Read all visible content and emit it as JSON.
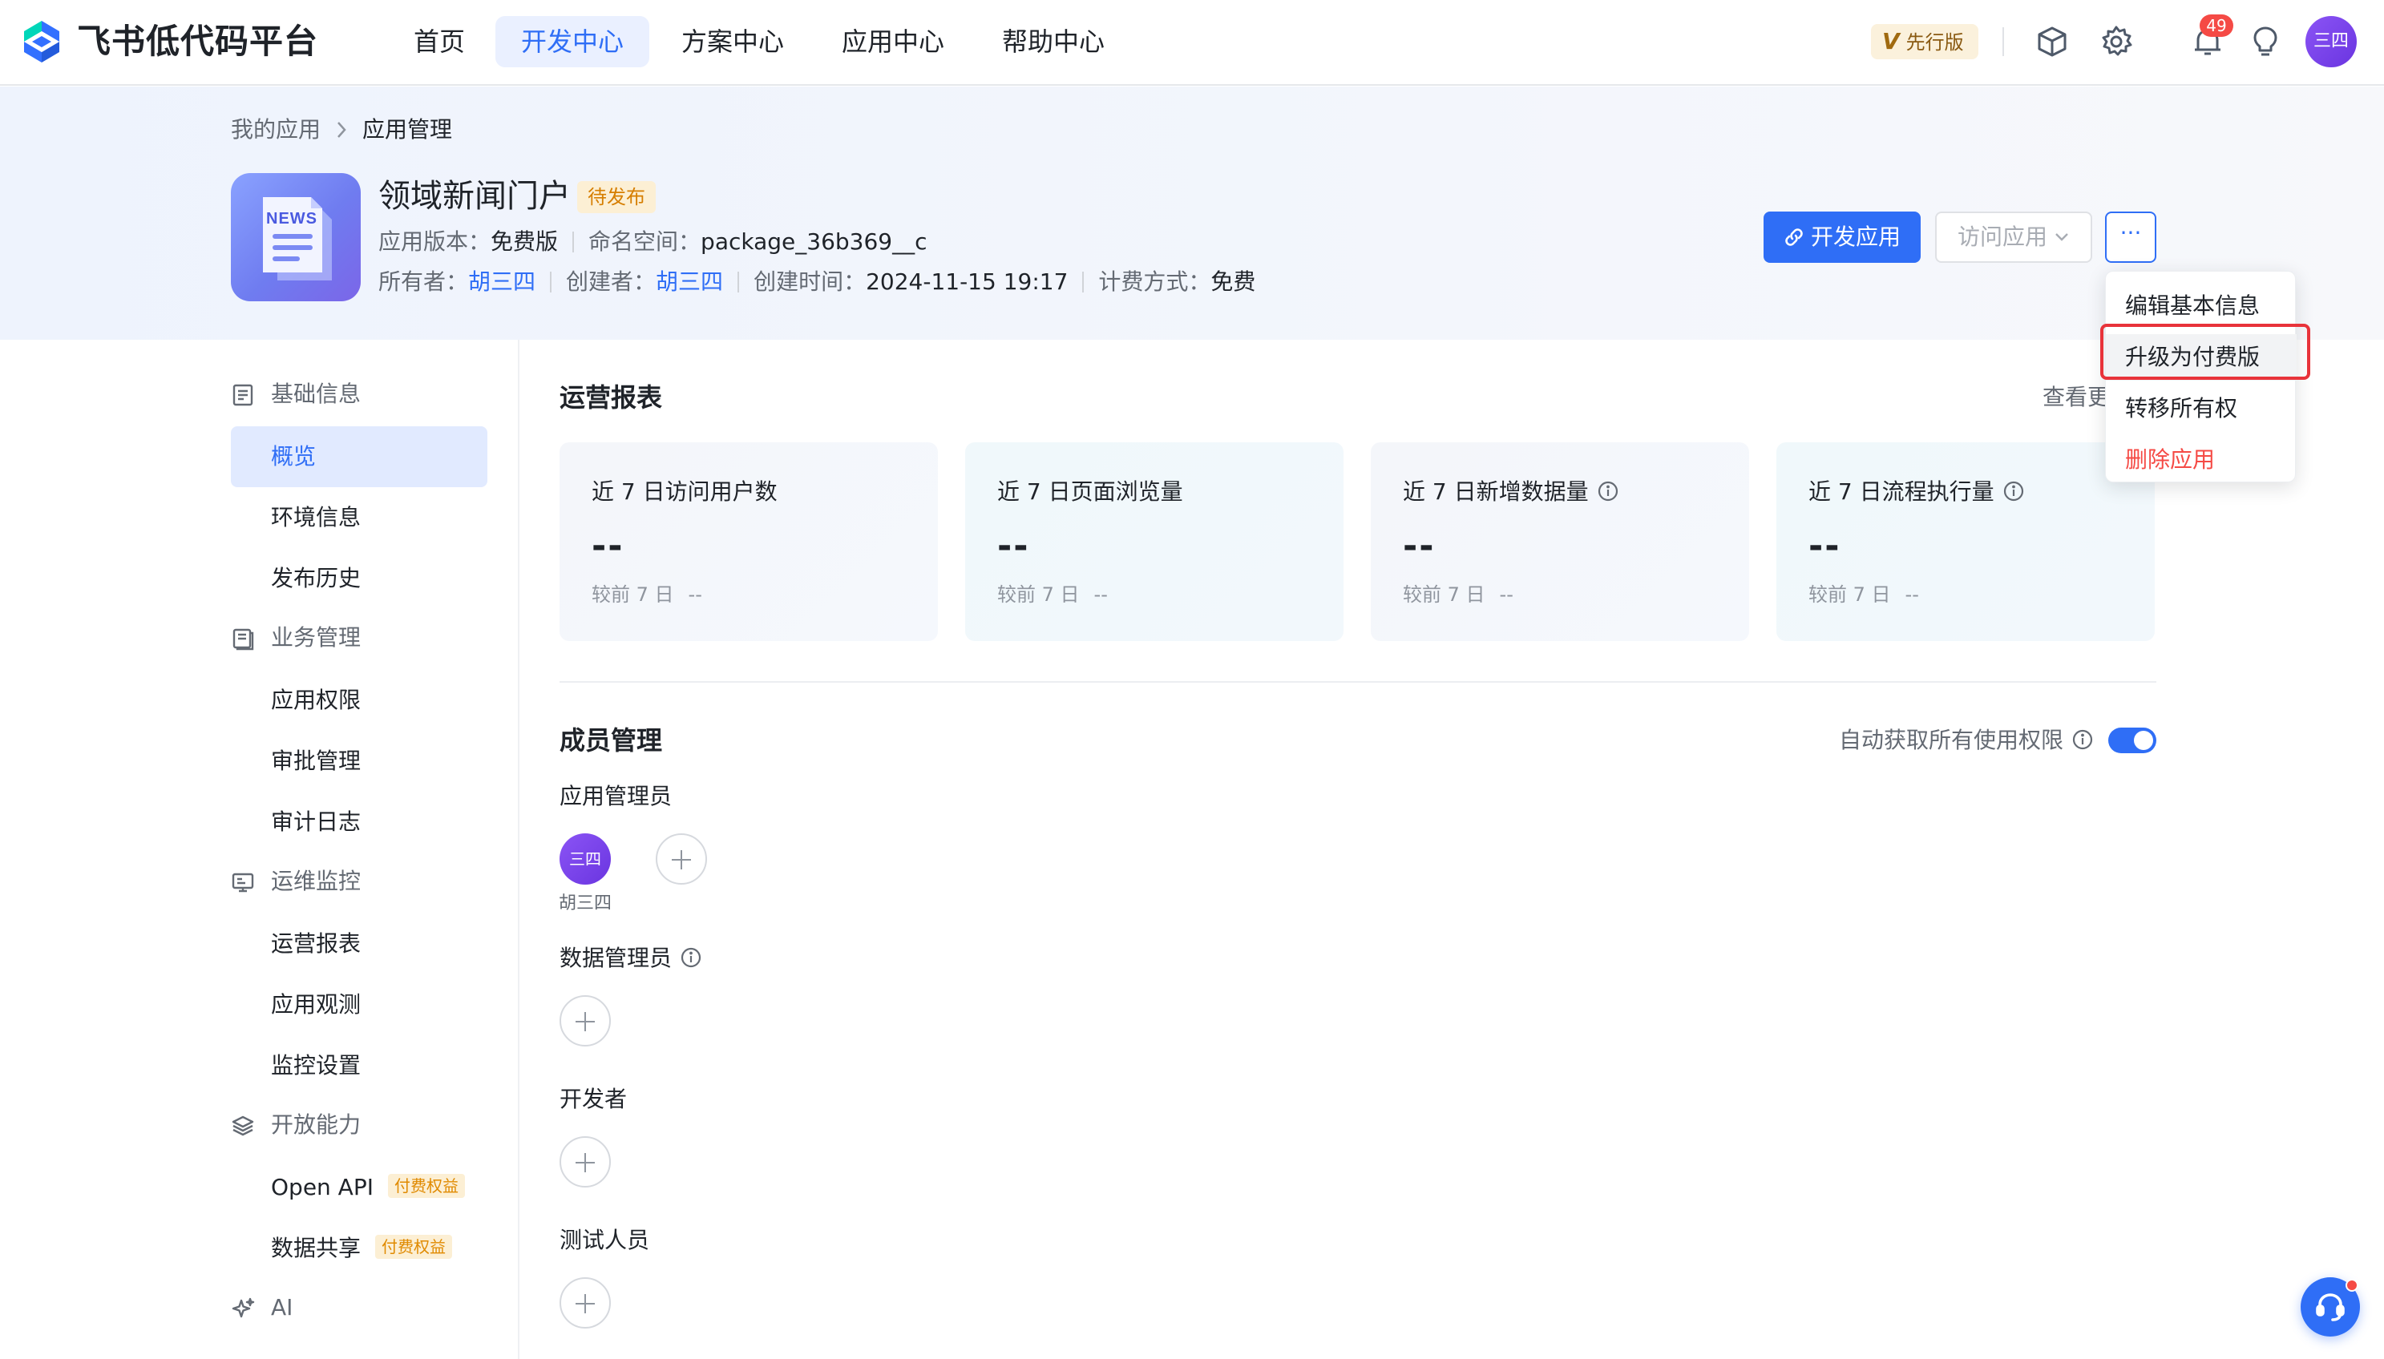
{
  "brand": {
    "name": "飞书低代码平台"
  },
  "nav": {
    "tabs": [
      {
        "label": "首页"
      },
      {
        "label": "开发中心"
      },
      {
        "label": "方案中心"
      },
      {
        "label": "应用中心"
      },
      {
        "label": "帮助中心"
      }
    ],
    "active_tab": "开发中心",
    "preview_badge": {
      "mark": "V",
      "label": "先行版"
    },
    "notification_count": "49",
    "user_avatar": "三四",
    "icons": [
      "cube-icon",
      "gear-icon",
      "bell-icon",
      "lightbulb-icon"
    ]
  },
  "breadcrumb": {
    "parent": "我的应用",
    "current": "应用管理"
  },
  "app": {
    "icon_text": "NEWS",
    "title": "领域新闻门户",
    "status": "待发布",
    "version_label": "应用版本：",
    "version": "免费版",
    "namespace_label": "命名空间：",
    "namespace": "package_36b369__c",
    "owner_label": "所有者：",
    "owner": "胡三四",
    "creator_label": "创建者：",
    "creator": "胡三四",
    "created_label": "创建时间：",
    "created_at": "2024-11-15 19:17",
    "billing_label": "计费方式：",
    "billing": "免费"
  },
  "actions": {
    "develop": "开发应用",
    "visit": "访问应用",
    "more": "···"
  },
  "more_menu": {
    "items": [
      {
        "label": "编辑基本信息"
      },
      {
        "label": "升级为付费版"
      },
      {
        "label": "转移所有权"
      },
      {
        "label": "删除应用"
      }
    ],
    "highlighted": "升级为付费版"
  },
  "sidebar": {
    "groups": [
      {
        "label": "基础信息",
        "icon": "document-icon"
      },
      {
        "label": "业务管理",
        "icon": "book-icon"
      },
      {
        "label": "运维监控",
        "icon": "monitor-icon"
      },
      {
        "label": "开放能力",
        "icon": "layers-icon"
      },
      {
        "label": "AI",
        "icon": "sparkle-icon"
      }
    ],
    "items": [
      {
        "label": "概览"
      },
      {
        "label": "环境信息"
      },
      {
        "label": "发布历史"
      },
      {
        "label": "应用权限"
      },
      {
        "label": "审批管理"
      },
      {
        "label": "审计日志"
      },
      {
        "label": "运营报表"
      },
      {
        "label": "应用观测"
      },
      {
        "label": "监控设置"
      },
      {
        "label": "Open API",
        "tag": "付费权益"
      },
      {
        "label": "数据共享",
        "tag": "付费权益"
      }
    ],
    "active_item": "概览"
  },
  "report": {
    "title": "运营报表",
    "view_more": "查看更",
    "cards": [
      {
        "title": "近 7 日访问用户数",
        "value": "--",
        "compare_label": "较前 7 日",
        "compare_value": "--"
      },
      {
        "title": "近 7 日页面浏览量",
        "value": "--",
        "compare_label": "较前 7 日",
        "compare_value": "--"
      },
      {
        "title": "近 7 日新增数据量",
        "value": "--",
        "compare_label": "较前 7 日",
        "compare_value": "--"
      },
      {
        "title": "近 7 日流程执行量",
        "value": "--",
        "compare_label": "较前 7 日",
        "compare_value": "--"
      }
    ]
  },
  "members": {
    "title": "成员管理",
    "auto_permission_label": "自动获取所有使用权限",
    "auto_permission_on": true,
    "roles": [
      {
        "label": "应用管理员",
        "members": [
          {
            "avatar": "三四",
            "name": "胡三四"
          }
        ]
      },
      {
        "label": "数据管理员",
        "members": []
      },
      {
        "label": "开发者",
        "members": []
      },
      {
        "label": "测试人员",
        "members": []
      }
    ]
  },
  "colors": {
    "accent": "#2f6ef6",
    "danger": "#f54a45",
    "pending_tag": "#d67e00",
    "avatar": "#7a45ea"
  }
}
